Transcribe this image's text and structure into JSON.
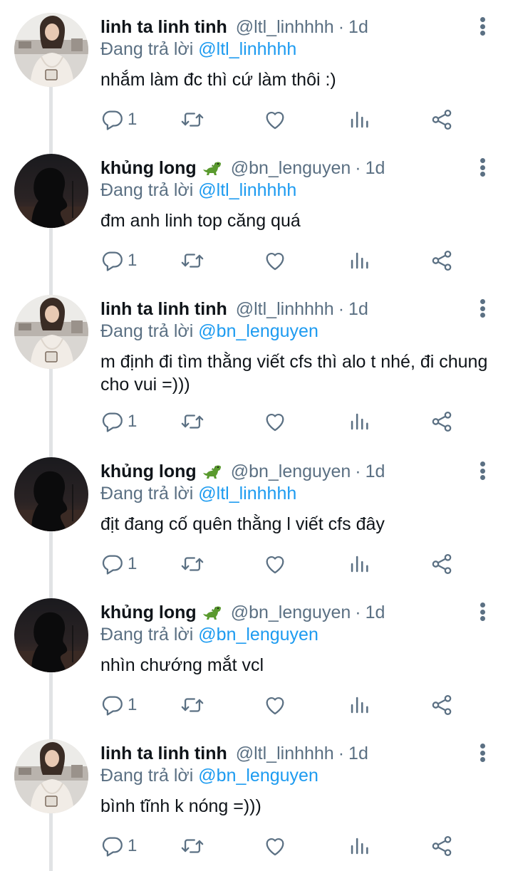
{
  "reply_prefix": "Đang trả lời",
  "tweets": [
    {
      "name": "linh ta linh tinh",
      "emoji": "",
      "handle": "@ltl_linhhhh",
      "time": "1d",
      "reply_to": "@ltl_linhhhh",
      "text": "nhắm làm đc thì cứ làm thôi :)",
      "reply_count": "1",
      "avatar": "woman-photo"
    },
    {
      "name": "khủng long",
      "emoji": "dinosaur-emoji",
      "handle": "@bn_lenguyen",
      "time": "1d",
      "reply_to": "@ltl_linhhhh",
      "text": "đm anh linh top căng quá",
      "reply_count": "1",
      "avatar": "dark-silhouette"
    },
    {
      "name": "linh ta linh tinh",
      "emoji": "",
      "handle": "@ltl_linhhhh",
      "time": "1d",
      "reply_to": "@bn_lenguyen",
      "text": "m định đi tìm thằng viết cfs thì alo t nhé, đi chung cho vui =)))",
      "reply_count": "1",
      "avatar": "woman-photo"
    },
    {
      "name": "khủng long",
      "emoji": "dinosaur-emoji",
      "handle": "@bn_lenguyen",
      "time": "1d",
      "reply_to": "@ltl_linhhhh",
      "text": "địt đang cố quên thằng l viết cfs đây",
      "reply_count": "1",
      "avatar": "dark-silhouette"
    },
    {
      "name": "khủng long",
      "emoji": "dinosaur-emoji",
      "handle": "@bn_lenguyen",
      "time": "1d",
      "reply_to": "@bn_lenguyen",
      "text": "nhìn chướng mắt vcl",
      "reply_count": "1",
      "avatar": "dark-silhouette"
    },
    {
      "name": "linh ta linh tinh",
      "emoji": "",
      "handle": "@ltl_linhhhh",
      "time": "1d",
      "reply_to": "@bn_lenguyen",
      "text": "bình tĩnh k nóng =)))",
      "reply_count": "1",
      "avatar": "woman-photo"
    }
  ],
  "colors": {
    "text": "#0f1419",
    "muted": "#5b7083",
    "link": "#1d9bf0",
    "thread_line": "#e1e3e5"
  }
}
